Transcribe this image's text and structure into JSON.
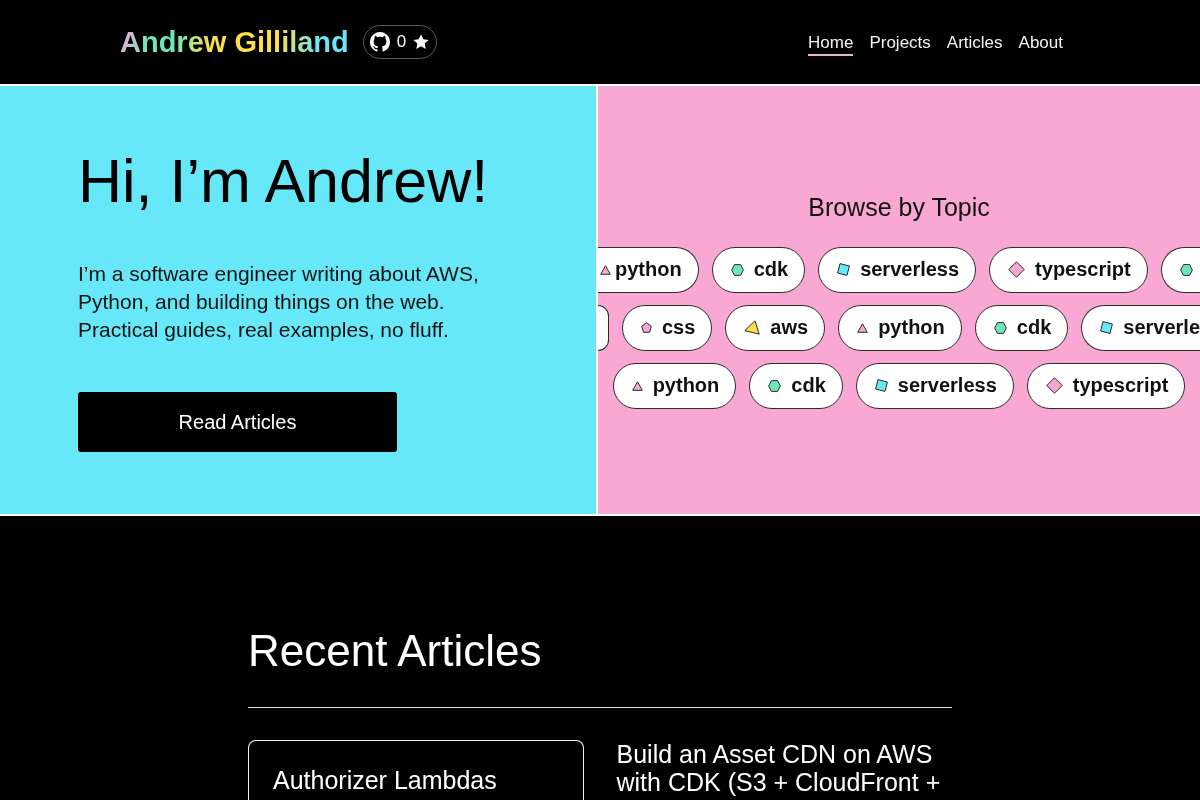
{
  "header": {
    "logo": "Andrew Gilliland",
    "github_badge": {
      "count": "0"
    },
    "nav": [
      {
        "label": "Home",
        "selected": true
      },
      {
        "label": "Projects",
        "selected": false
      },
      {
        "label": "Articles",
        "selected": false
      },
      {
        "label": "About",
        "selected": false
      }
    ]
  },
  "hero": {
    "heading": "Hi, I’m Andrew!",
    "intro": "I’m a software engineer writing about AWS, Python, and building things on the web. Practical guides, real examples, no fluff.",
    "button": "Read Articles"
  },
  "topics": {
    "title": "Browse by Topic",
    "rows": [
      {
        "tags": [
          {
            "label": "python",
            "kind": "triangle",
            "color": "#f9a8d4",
            "cut_left": true,
            "cut_right": false
          },
          {
            "label": "cdk",
            "kind": "hexagon",
            "color": "#6ee7b7",
            "cut_left": false,
            "cut_right": false
          },
          {
            "label": "serverless",
            "kind": "square",
            "color": "#67e8f9",
            "cut_left": false,
            "cut_right": false
          },
          {
            "label": "typescript",
            "kind": "diamond",
            "color": "#f9a8d4",
            "cut_left": false,
            "cut_right": false
          },
          {
            "kind": "hexagon",
            "color": "#6ee7b7",
            "cut_left": false,
            "cut_right": true
          }
        ]
      },
      {
        "tags": [
          {
            "cut_left": true,
            "cut_right": false
          },
          {
            "label": "css",
            "kind": "pentagon",
            "color": "#f9a8d4",
            "cut_left": false,
            "cut_right": false
          },
          {
            "label": "aws",
            "kind": "wedge",
            "color": "#fde047",
            "cut_left": false,
            "cut_right": false
          },
          {
            "label": "python",
            "kind": "triangle",
            "color": "#f9a8d4",
            "cut_left": false,
            "cut_right": false
          },
          {
            "label": "cdk",
            "kind": "hexagon",
            "color": "#6ee7b7",
            "cut_left": false,
            "cut_right": false
          },
          {
            "label": "serverle",
            "kind": "square",
            "color": "#67e8f9",
            "cut_left": false,
            "cut_right": true
          }
        ]
      },
      {
        "tags": [
          {
            "label": "python",
            "kind": "triangle",
            "color": "#f9a8d4",
            "cut_left": false,
            "cut_right": false
          },
          {
            "label": "cdk",
            "kind": "hexagon",
            "color": "#6ee7b7",
            "cut_left": false,
            "cut_right": false
          },
          {
            "label": "serverless",
            "kind": "square",
            "color": "#67e8f9",
            "cut_left": false,
            "cut_right": false
          },
          {
            "label": "typescript",
            "kind": "diamond",
            "color": "#f9a8d4",
            "cut_left": false,
            "cut_right": false
          }
        ]
      }
    ]
  },
  "recent_articles": {
    "title": "Recent Articles",
    "articles": [
      {
        "title": "Authorizer Lambdas",
        "highlighted": true
      },
      {
        "title": "Build an Asset CDN on AWS with CDK (S3 + CloudFront +",
        "highlighted": false
      }
    ]
  }
}
